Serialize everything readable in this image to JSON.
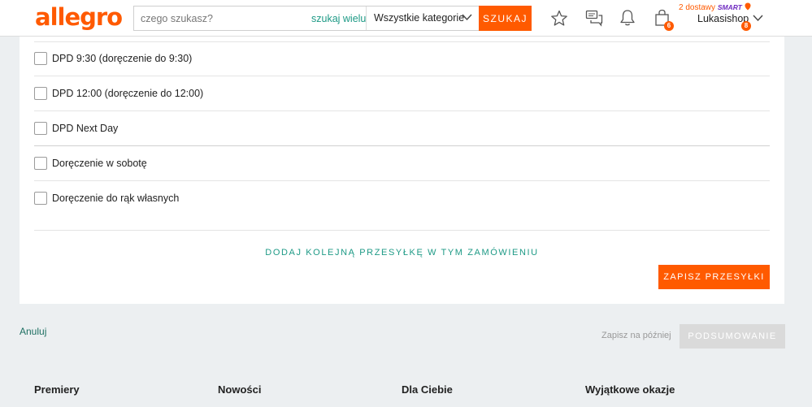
{
  "header": {
    "logo": "allegro",
    "search_placeholder": "czego szukasz?",
    "search_many": "szukaj wielu",
    "category": "Wszystkie kategorie",
    "search_button": "SZUKAJ",
    "cart_badge": "6",
    "smart_prefix": "2 dostawy",
    "smart_tag": "SMART",
    "user_name": "Lukasishop",
    "user_badge": "8"
  },
  "shipping": {
    "options": [
      {
        "label": "DPD 9:30 (doręczenie do 9:30)",
        "checked": false
      },
      {
        "label": "DPD 12:00 (doręczenie do 12:00)",
        "checked": false
      },
      {
        "label": "DPD Next Day",
        "checked": false
      },
      {
        "label": "Doręczenie w sobotę",
        "checked": false
      },
      {
        "label": "Doręczenie do rąk własnych",
        "checked": false
      }
    ],
    "add_shipment": "DODAJ KOLEJNĄ PRZESYŁKĘ W TYM ZAMÓWIENIU",
    "save_button": "ZAPISZ PRZESYŁKI"
  },
  "actions": {
    "cancel": "Anuluj",
    "save_later": "Zapisz na później",
    "summary_button": "PODSUMOWANIE"
  },
  "footer": {
    "headings": [
      "Premiery",
      "Nowości",
      "Dla Ciebie",
      "Wyjątkowe okazje"
    ]
  },
  "colors": {
    "accent": "#ff5a00",
    "link": "#1e9a86",
    "smart": "#6f2bc1"
  }
}
